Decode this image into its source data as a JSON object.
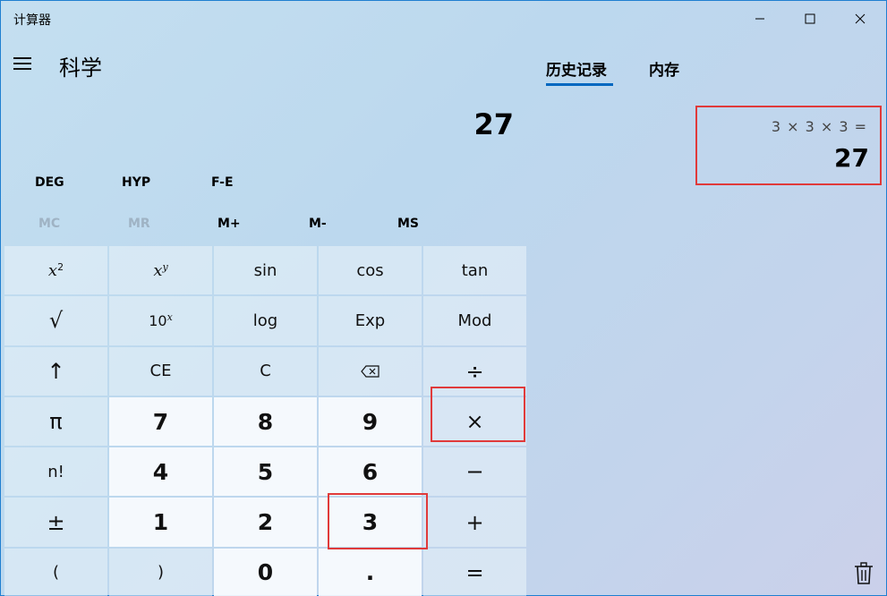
{
  "app": {
    "title": "计算器"
  },
  "header": {
    "mode": "科学"
  },
  "display": {
    "value": "27"
  },
  "modes": {
    "deg": "DEG",
    "hyp": "HYP",
    "fe": "F-E"
  },
  "memory": {
    "mc": "MC",
    "mr": "MR",
    "mplus": "M+",
    "mminus": "M-",
    "ms": "MS"
  },
  "keys": {
    "r1": {
      "sin": "sin",
      "cos": "cos",
      "tan": "tan"
    },
    "r2": {
      "sqrt": "√",
      "log": "log",
      "exp": "Exp",
      "mod": "Mod"
    },
    "r3": {
      "shift": "↑",
      "ce": "CE",
      "c": "C",
      "div": "÷"
    },
    "r4": {
      "pi": "π",
      "n7": "7",
      "n8": "8",
      "n9": "9",
      "mul": "×"
    },
    "r5": {
      "fact": "n!",
      "n4": "4",
      "n5": "5",
      "n6": "6",
      "minus": "−"
    },
    "r6": {
      "negate": "±",
      "n1": "1",
      "n2": "2",
      "n3": "3",
      "plus": "+"
    },
    "r7": {
      "lparen": "(",
      "rparen": ")",
      "n0": "0",
      "dot": ".",
      "eq": "="
    }
  },
  "tabs": {
    "history": "历史记录",
    "memory": "内存"
  },
  "history": [
    {
      "expression": "3 × 3 × 3 =",
      "result": "27"
    }
  ],
  "colors": {
    "accent": "#0067c0",
    "highlight": "#e03a3a"
  }
}
